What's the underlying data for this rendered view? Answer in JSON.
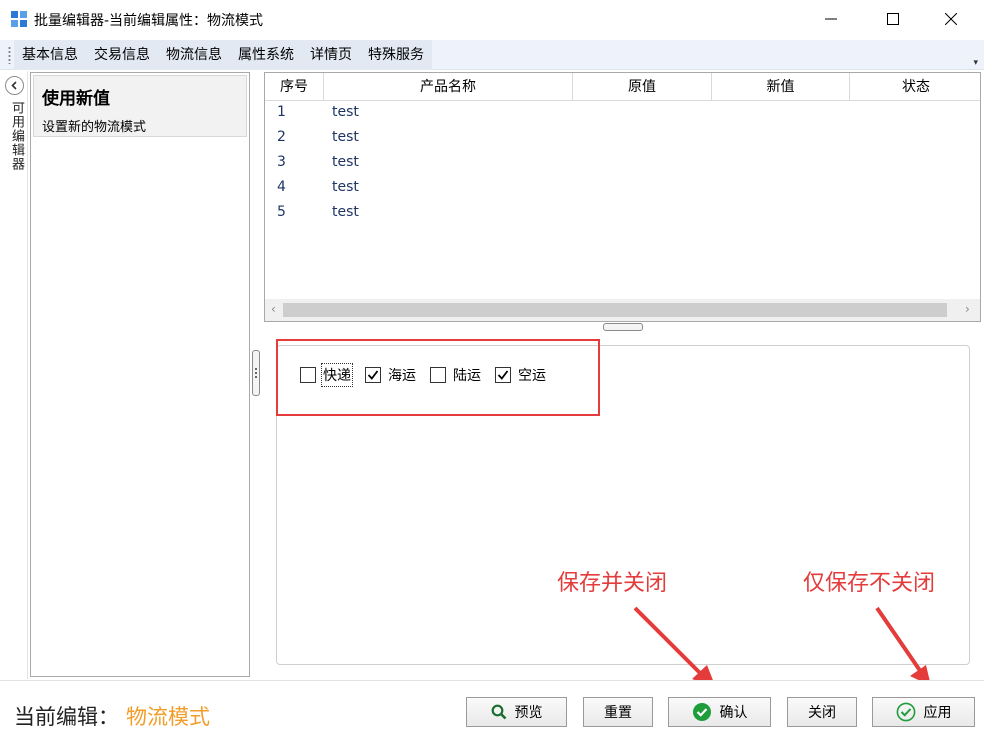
{
  "window": {
    "title": "批量编辑器-当前编辑属性：物流模式"
  },
  "menu": {
    "items": [
      "基本信息",
      "交易信息",
      "物流信息",
      "属性系统",
      "详情页",
      "特殊服务"
    ],
    "overflow": "▾"
  },
  "sidebar": {
    "tab_label": "可用编辑器",
    "editor": {
      "title": "使用新值",
      "desc": "设置新的物流模式"
    }
  },
  "grid": {
    "columns": [
      "序号",
      "产品名称",
      "原值",
      "新值",
      "状态"
    ],
    "rows": [
      {
        "idx": "1",
        "name": "test"
      },
      {
        "idx": "2",
        "name": "test"
      },
      {
        "idx": "3",
        "name": "test"
      },
      {
        "idx": "4",
        "name": "test"
      },
      {
        "idx": "5",
        "name": "test"
      }
    ]
  },
  "options": [
    {
      "label": "快递",
      "checked": false
    },
    {
      "label": "海运",
      "checked": true
    },
    {
      "label": "陆运",
      "checked": false
    },
    {
      "label": "空运",
      "checked": true
    }
  ],
  "annotations": {
    "save_close": "保存并关闭",
    "save_only": "仅保存不关闭"
  },
  "footer": {
    "current_label": "当前编辑：",
    "current_value": "物流模式",
    "buttons": {
      "preview": "预览",
      "reset": "重置",
      "confirm": "确认",
      "close": "关闭",
      "apply": "应用"
    }
  },
  "colors": {
    "accent_orange": "#f29d2a",
    "annotation_red": "#e43b3b",
    "confirm_green": "#1f9d3a"
  }
}
